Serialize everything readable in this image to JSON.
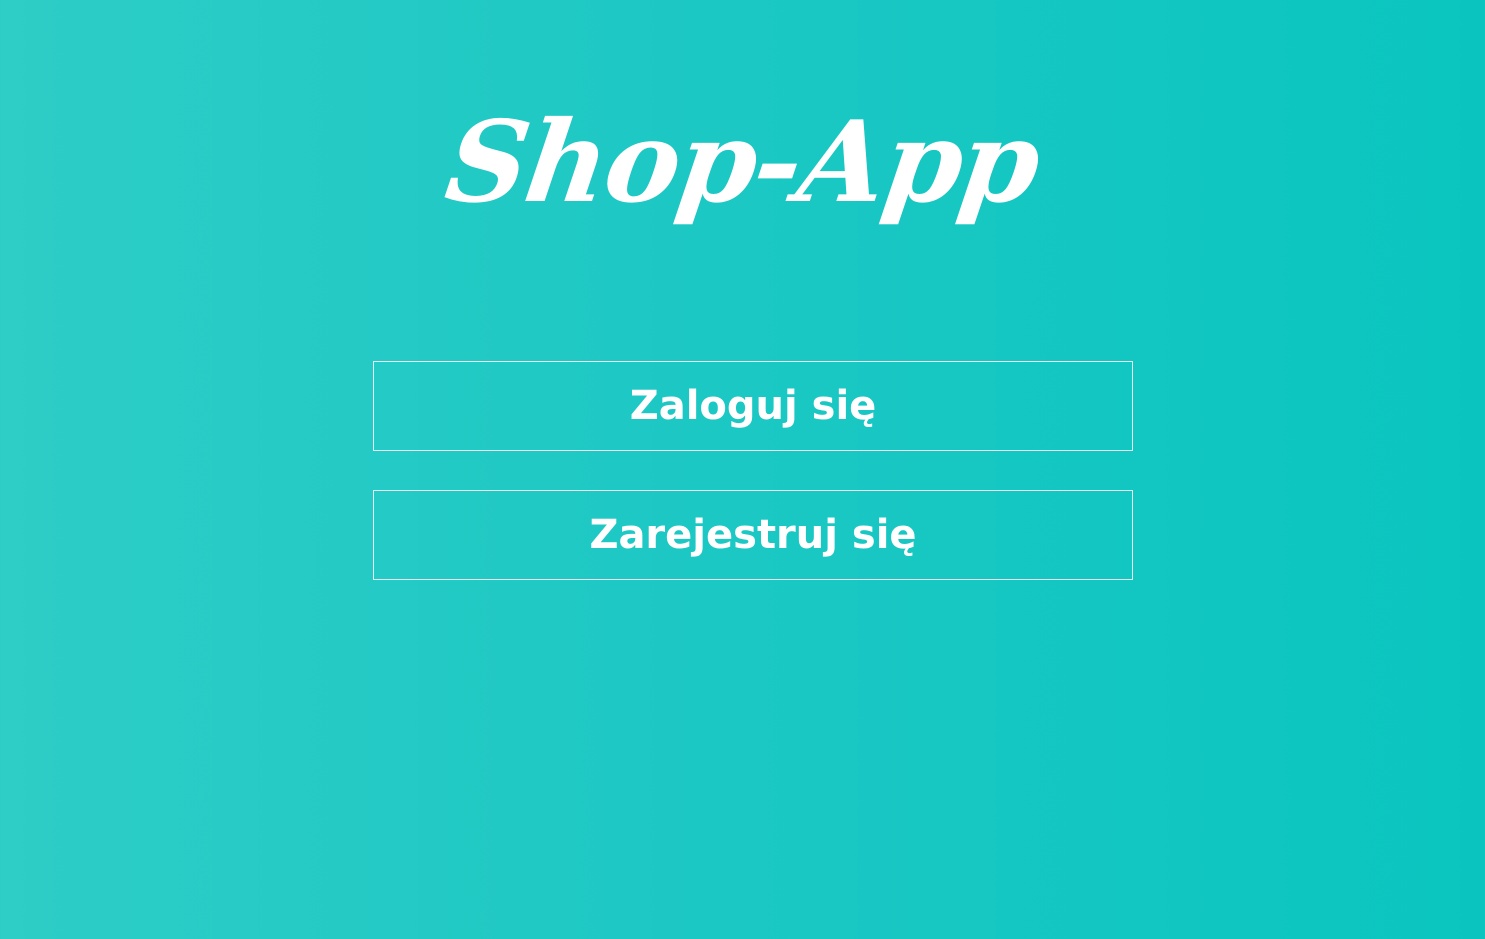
{
  "app": {
    "logo_text": "Shop-App"
  },
  "actions": {
    "login_label": "Zaloguj się",
    "register_label": "Zarejestruj się"
  },
  "colors": {
    "background_start": "#2ecdc6",
    "background_end": "#0ac5bf",
    "foreground": "#ffffff"
  }
}
